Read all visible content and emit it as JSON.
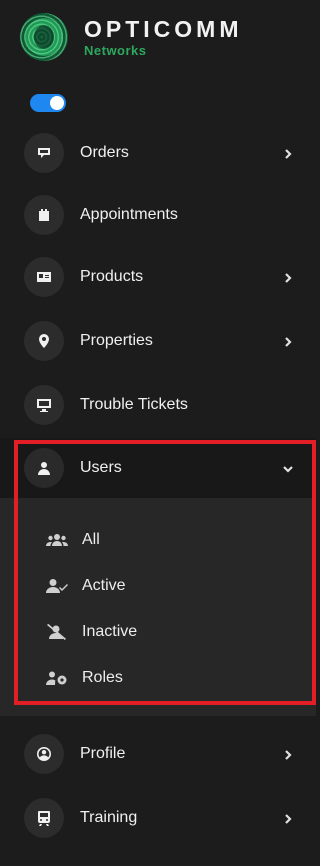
{
  "logo": {
    "title": "OPTICOMM",
    "subtitle": "Networks"
  },
  "toggle": {
    "state": "on",
    "color": "#1e88f0"
  },
  "menu": {
    "orders": {
      "label": "Orders",
      "icon": "orders-icon"
    },
    "appointments": {
      "label": "Appointments",
      "icon": "calendar-icon"
    },
    "products": {
      "label": "Products",
      "icon": "id-card-icon"
    },
    "properties": {
      "label": "Properties",
      "icon": "map-pin-icon"
    },
    "trouble_tickets": {
      "label": "Trouble Tickets",
      "icon": "monitor-icon"
    },
    "users": {
      "label": "Users",
      "icon": "user-icon",
      "expanded": true,
      "submenu": [
        {
          "label": "All",
          "icon": "users-group-icon"
        },
        {
          "label": "Active",
          "icon": "user-check-icon"
        },
        {
          "label": "Inactive",
          "icon": "user-slash-icon"
        },
        {
          "label": "Roles",
          "icon": "user-cog-icon"
        }
      ]
    },
    "profile": {
      "label": "Profile",
      "icon": "user-circle-icon"
    },
    "training": {
      "label": "Training",
      "icon": "train-icon"
    }
  },
  "highlight_color": "#e41e26"
}
